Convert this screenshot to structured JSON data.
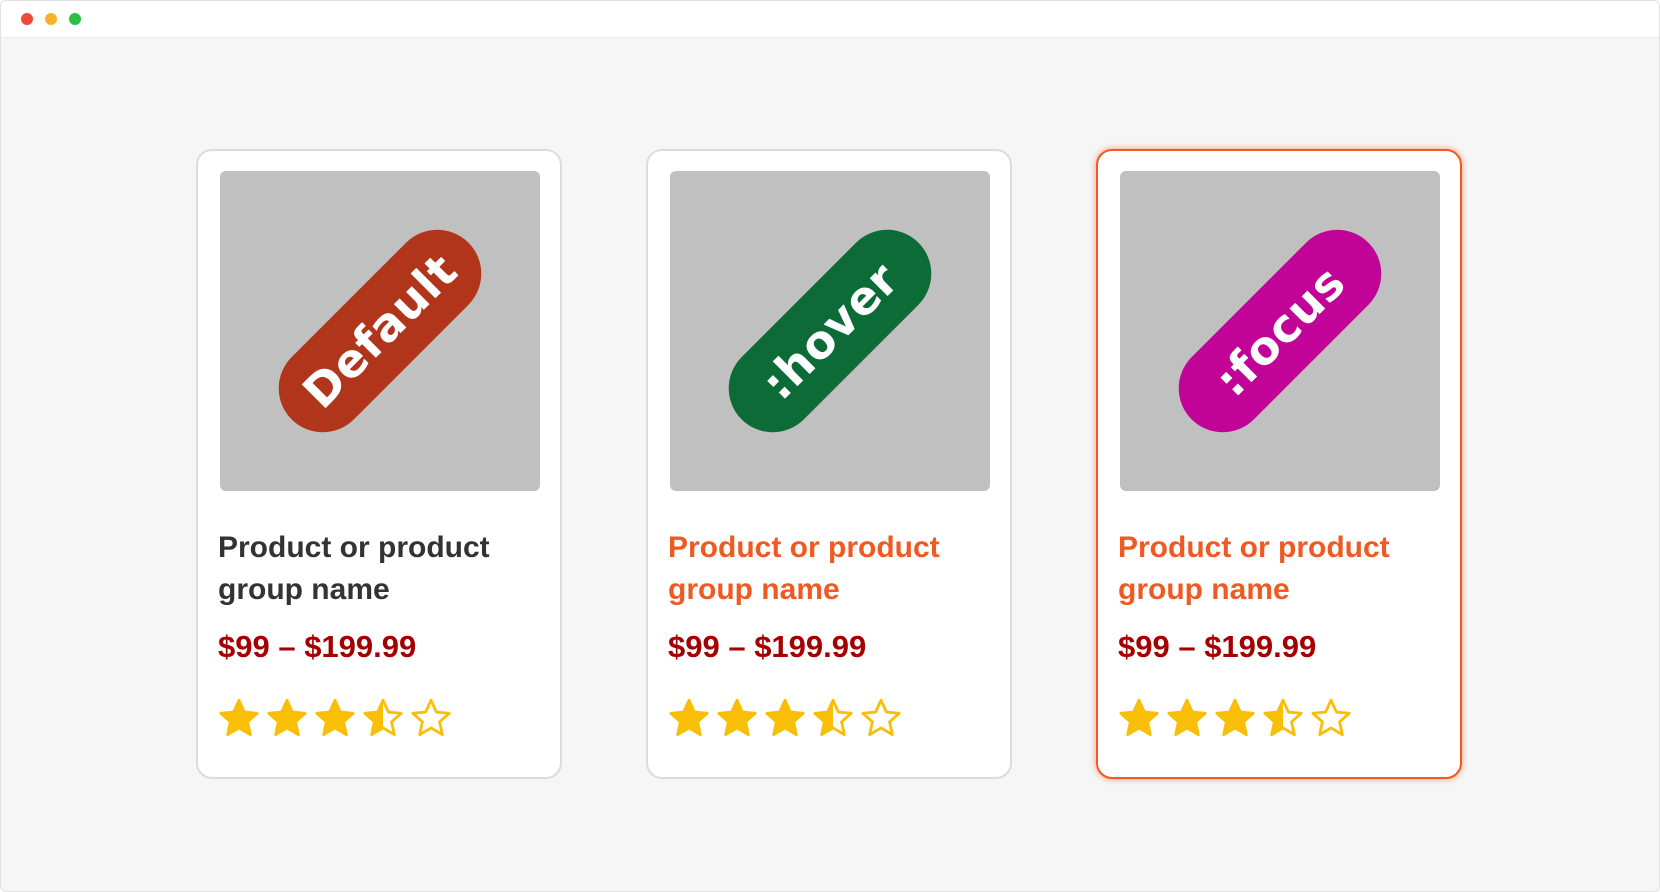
{
  "window": {
    "controls": [
      {
        "name": "close-button",
        "color": "#ee4a37"
      },
      {
        "name": "minimize-button",
        "color": "#f6b22b"
      },
      {
        "name": "zoom-button",
        "color": "#28c141"
      }
    ]
  },
  "colors": {
    "name_default": "#333333",
    "name_active": "#ef5a22",
    "price": "#a50000",
    "star": "#f9bf07",
    "focus_ring": "#ef5a22"
  },
  "cards": [
    {
      "state_label": "Default",
      "pill_color": "#b1351b",
      "name": "Product or product group name",
      "price": "$99 – $199.99",
      "rating": 3.5,
      "rating_max": 5
    },
    {
      "state_label": ":hover",
      "pill_color": "#0d6b37",
      "name": "Product or product group name",
      "price": "$99 – $199.99",
      "rating": 3.5,
      "rating_max": 5
    },
    {
      "state_label": ":focus",
      "pill_color": "#c10497",
      "name": "Product or product group name",
      "price": "$99 – $199.99",
      "rating": 3.5,
      "rating_max": 5
    }
  ]
}
